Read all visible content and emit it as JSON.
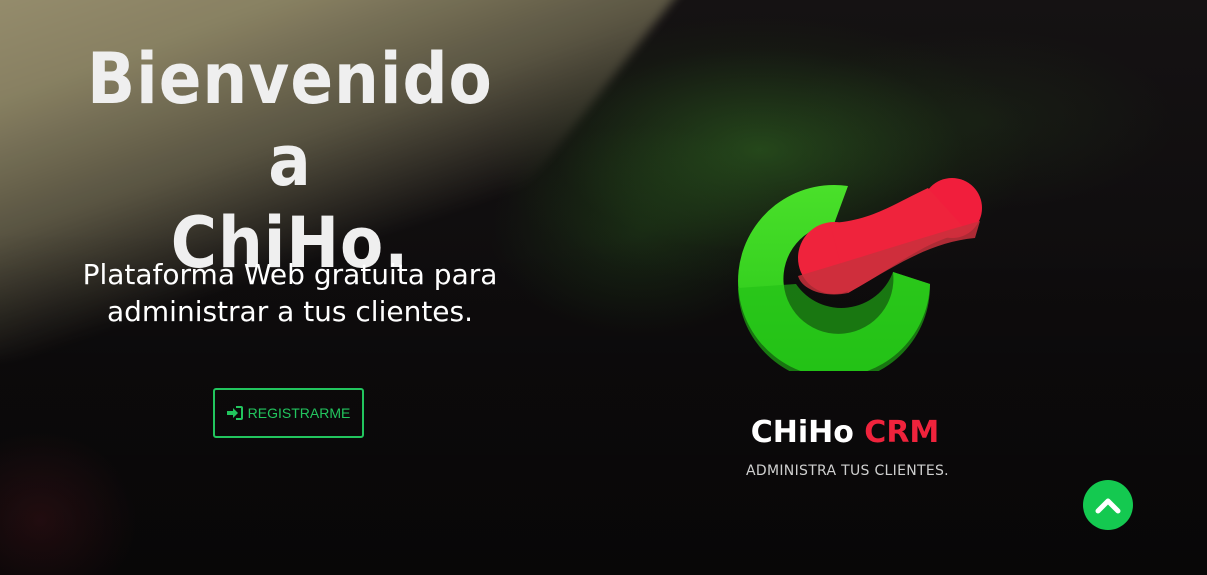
{
  "hero": {
    "title_line1": "Bienvenido a",
    "title_line2": "ChiHo.",
    "subtitle_line1": "Plataforma Web gratuita para",
    "subtitle_line2": "administrar a tus clientes.",
    "register_label": "REGISTRARME",
    "register_icon": "sign-in-icon"
  },
  "brand": {
    "name_part1": "CHiHo",
    "name_part2": "CRM",
    "tagline": "ADMINISTRA TUS CLIENTES.",
    "logo_icon": "chiho-logo-icon"
  },
  "scroll_top": {
    "icon": "chevron-up-icon"
  },
  "colors": {
    "background": "#0e0c0d",
    "accent_green": "#22c55e",
    "logo_green": "#3fd62a",
    "logo_red": "#ef233c",
    "text_white": "#ffffff"
  }
}
